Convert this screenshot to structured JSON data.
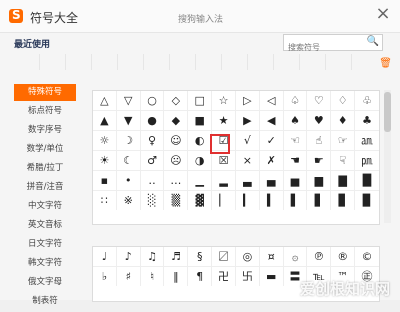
{
  "title": "符号大全",
  "input_method": "搜狗输入法",
  "close_symbol": "×",
  "recent_label": "最近使用",
  "search_placeholder": "搜索符号",
  "search_icon": "🔍",
  "trash_icon": "🗑",
  "categories": [
    {
      "label": "特殊符号",
      "active": true
    },
    {
      "label": "标点符号"
    },
    {
      "label": "数字序号"
    },
    {
      "label": "数学/单位"
    },
    {
      "label": "希腊/拉丁"
    },
    {
      "label": "拼音/注音"
    },
    {
      "label": "中文字符"
    },
    {
      "label": "英文音标"
    },
    {
      "label": "日文字符"
    },
    {
      "label": "韩文字符"
    },
    {
      "label": "俄文字母"
    },
    {
      "label": "制表符"
    }
  ],
  "symbols_main": [
    [
      "△",
      "▽",
      "○",
      "◇",
      "□",
      "☆",
      "▷",
      "◁",
      "♤",
      "♡",
      "♢",
      "♧"
    ],
    [
      "▲",
      "▼",
      "●",
      "◆",
      "■",
      "★",
      "▶",
      "◀",
      "♠",
      "♥",
      "♦",
      "♣"
    ],
    [
      "☼",
      "☽",
      "♀",
      "☺",
      "◐",
      "☑",
      "√",
      "✓",
      "☜",
      "☝",
      "☞",
      "㏂"
    ],
    [
      "☀",
      "☾",
      "♂",
      "☹",
      "◑",
      "☒",
      "×",
      "✗",
      "☚",
      "☛",
      "☟",
      "㏘"
    ],
    [
      "▪",
      "•",
      "‥",
      "…",
      "▁",
      "▂",
      "▃",
      "▄",
      "▅",
      "▆",
      "▇",
      "█"
    ],
    [
      "∷",
      "※",
      "░",
      "▒",
      "▓",
      "▏",
      "▎",
      "▍",
      "▌",
      "▋",
      "▊",
      "▉"
    ]
  ],
  "symbols_bottom": [
    [
      "♩",
      "♪",
      "♫",
      "♬",
      "§",
      "〼",
      "◎",
      "¤",
      "۞",
      "℗",
      "®",
      "©"
    ],
    [
      "♭",
      "♯",
      "♮",
      "‖",
      "¶",
      "卍",
      "卐",
      "▬",
      "〓",
      "℡",
      "™",
      "㊣"
    ]
  ],
  "watermark": "爱创根知识网"
}
